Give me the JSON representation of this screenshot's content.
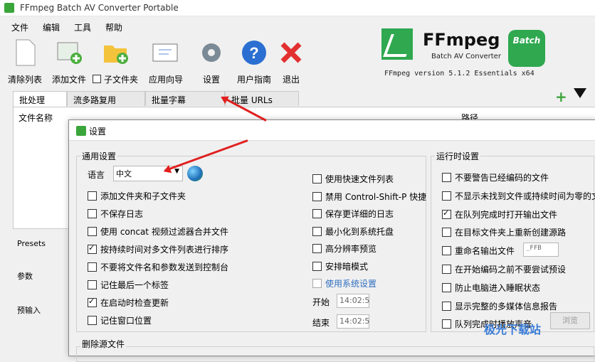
{
  "window": {
    "title": "FFmpeg Batch AV Converter Portable"
  },
  "menu": [
    "文件",
    "编辑",
    "工具",
    "帮助"
  ],
  "toolbar": {
    "clear": "清除列表",
    "add_files": "添加文件",
    "subfolder": "子文件夹",
    "wizard": "应用向导",
    "settings": "设置",
    "guide": "用户指南",
    "exit": "退出"
  },
  "brand": {
    "name": "FFmpeg",
    "subtitle": "Batch AV Converter",
    "badge": "Batch",
    "version": "FFmpeg version 5.1.2 Essentials  x64"
  },
  "tabs": [
    "批处理",
    "流多路复用",
    "批量字幕",
    "批量 URLs"
  ],
  "main": {
    "col_name": "文件名称",
    "col_path": "路径"
  },
  "side": {
    "presets": "Presets",
    "params": "参数",
    "preinput": "预输入"
  },
  "dialog": {
    "title": "设置",
    "general": {
      "title": "通用设置",
      "lang_label": "语言",
      "lang_value": "中文",
      "left_items": [
        {
          "label": "添加文件夹和子文件夹",
          "checked": false
        },
        {
          "label": "不保存日志",
          "checked": false
        },
        {
          "label": "使用 concat 视频过滤器合并文件",
          "checked": false
        },
        {
          "label": "按持续时间对多文件列表进行排序",
          "checked": true
        },
        {
          "label": "不要将文件名和参数发送到控制台",
          "checked": false
        },
        {
          "label": "记住最后一个标签",
          "checked": false
        },
        {
          "label": "在启动时检查更新",
          "checked": true
        },
        {
          "label": "记住窗口位置",
          "checked": false
        }
      ],
      "right_items": [
        {
          "label": "使用快速文件列表",
          "checked": false
        },
        {
          "label": "禁用 Control-Shift-P 快捷",
          "checked": false
        },
        {
          "label": "保存更详细的日志",
          "checked": false
        },
        {
          "label": "最小化到系统托盘",
          "checked": false
        },
        {
          "label": "高分辨率预览",
          "checked": false
        },
        {
          "label": "安排暗模式",
          "checked": false
        },
        {
          "label": "使用系统设置",
          "checked": false
        }
      ],
      "start_label": "开始",
      "start_value": "14:02:5",
      "end_label": "结束",
      "end_value": "14:02:5"
    },
    "runtime": {
      "title": "运行时设置",
      "items": [
        {
          "label": "不要警告已经编码的文件",
          "checked": false
        },
        {
          "label": "不显示未找到文件或持续时间为零的文",
          "checked": false
        },
        {
          "label": "在队列完成时打开输出文件",
          "checked": true
        },
        {
          "label": "在目标文件夹上重新创建源路",
          "checked": false
        },
        {
          "label": "重命名输出文件",
          "checked": false
        },
        {
          "label": "在开始编码之前不要尝试预设",
          "checked": false
        },
        {
          "label": "防止电脑进入睡眠状态",
          "checked": false
        },
        {
          "label": "显示完整的多媒体信息报告",
          "checked": false
        },
        {
          "label": "队列完成时播放声音",
          "checked": false
        }
      ],
      "rename_suffix": "_FFB",
      "browse": "浏览"
    },
    "delete_source": "删除源文件"
  },
  "watermark": "极光下载站"
}
